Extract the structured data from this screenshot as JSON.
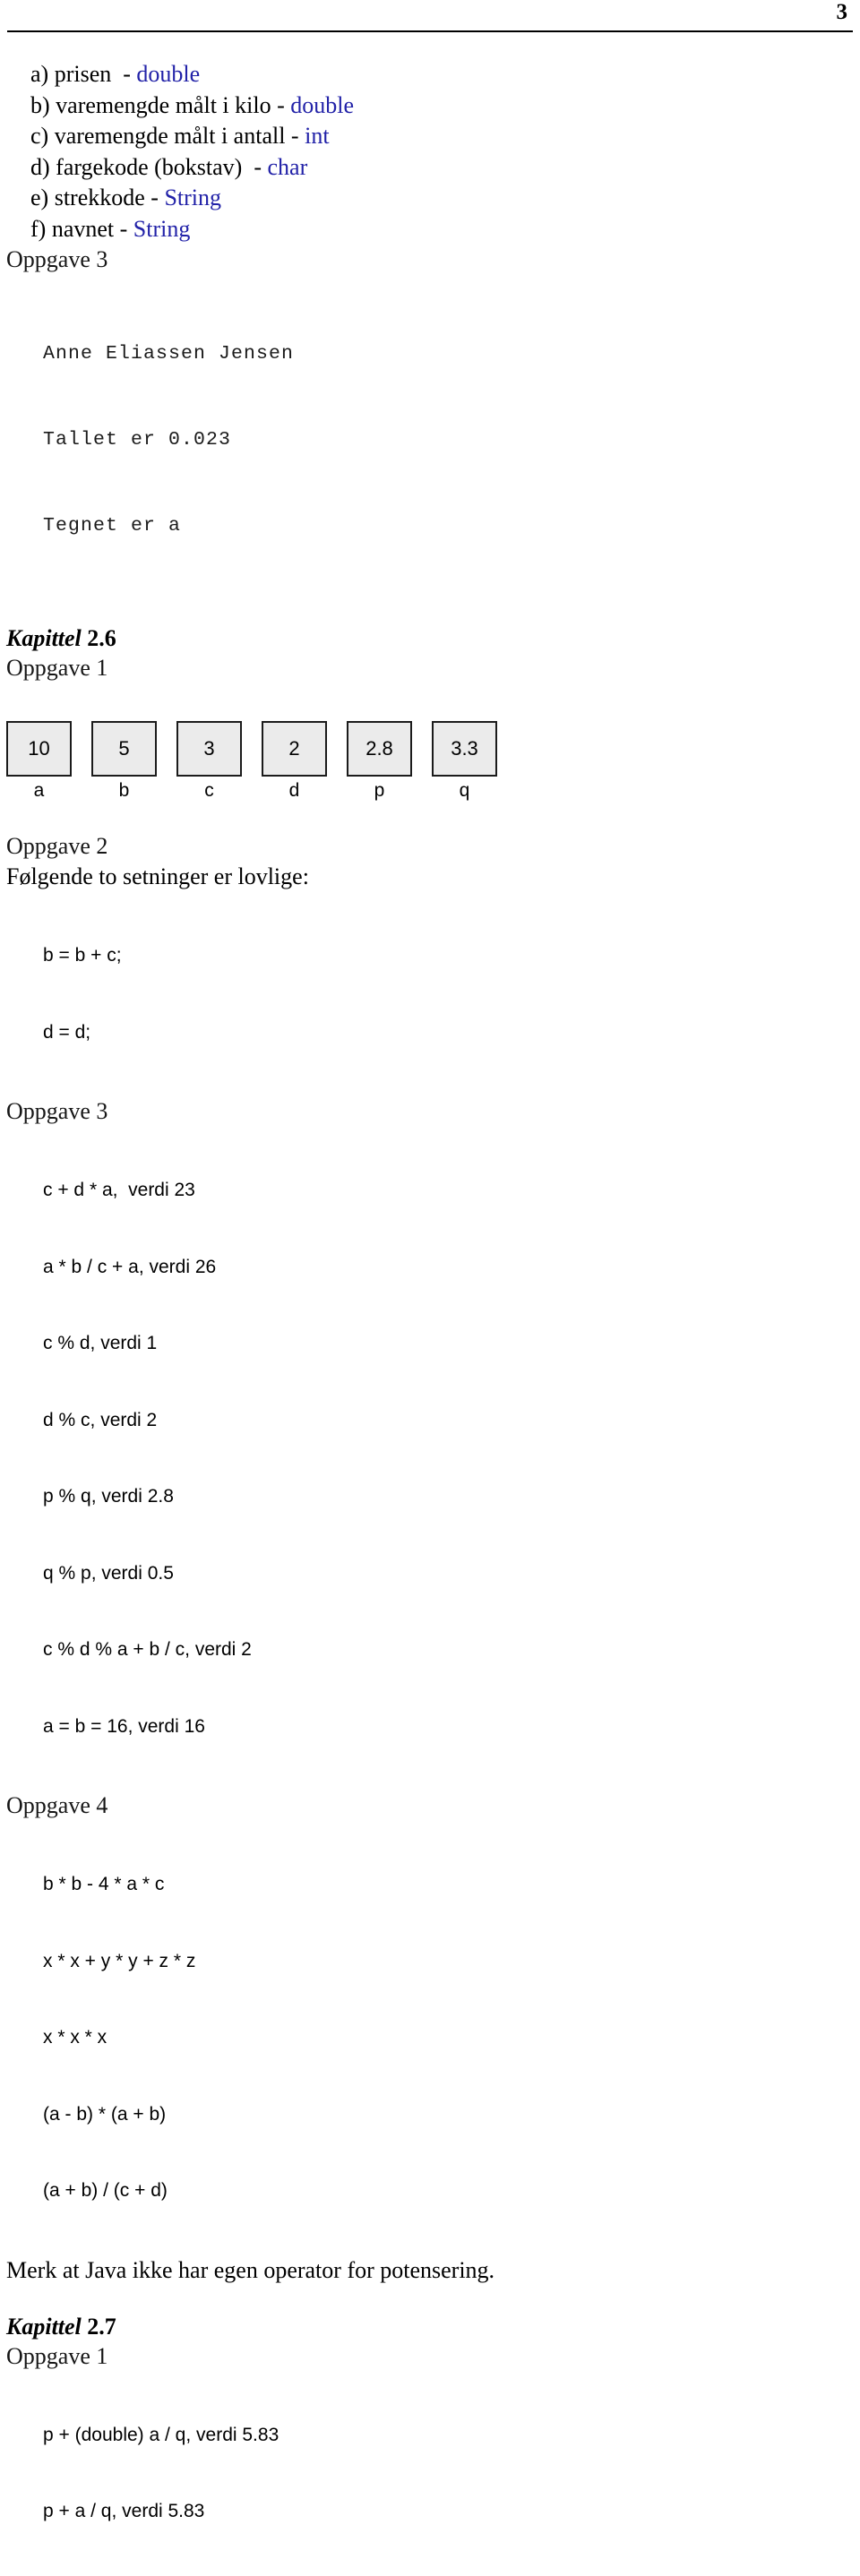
{
  "header": {
    "page_number": "3"
  },
  "types_list": [
    {
      "label": "a) prisen  - ",
      "type": "double"
    },
    {
      "label": "b) varemengde målt i kilo - ",
      "type": "double"
    },
    {
      "label": "c) varemengde målt i antall - ",
      "type": "int"
    },
    {
      "label": "d) fargekode (bokstav)  - ",
      "type": "char"
    },
    {
      "label": "e) strekkode - ",
      "type": "String"
    },
    {
      "label": "f) navnet - ",
      "type": "String"
    }
  ],
  "section_oppgave3_top": {
    "heading": "Oppgave 3",
    "console_lines": [
      "Anne Eliassen Jensen",
      "Tallet er 0.023",
      "Tegnet er a"
    ]
  },
  "kapittel_2_6": {
    "title_word": "Kapittel ",
    "title_number": "2.6",
    "oppgave1": {
      "heading": "Oppgave 1",
      "boxes": [
        {
          "value": "10",
          "label": "a"
        },
        {
          "value": "5",
          "label": "b"
        },
        {
          "value": "3",
          "label": "c"
        },
        {
          "value": "2",
          "label": "d"
        },
        {
          "value": "2.8",
          "label": "p"
        },
        {
          "value": "3.3",
          "label": "q"
        }
      ]
    },
    "oppgave2": {
      "heading": "Oppgave 2",
      "intro": "Følgende to setninger er lovlige:",
      "statements": [
        "b = b + c;",
        "d = d;"
      ]
    },
    "oppgave3": {
      "heading": "Oppgave 3",
      "expressions": [
        "c + d * a,  verdi 23",
        "a * b / c + a, verdi 26",
        "c % d, verdi 1",
        "d % c, verdi 2",
        "p % q, verdi 2.8",
        "q % p, verdi 0.5",
        "c % d % a + b / c, verdi 2",
        "a = b = 16, verdi 16"
      ]
    },
    "oppgave4": {
      "heading": "Oppgave 4",
      "expressions": [
        "b * b - 4 * a * c",
        "x * x + y * y + z * z",
        "x * x * x",
        "(a - b) * (a + b)",
        "(a + b) / (c + d)"
      ],
      "note": "Merk at Java ikke har egen operator for potensering."
    }
  },
  "kapittel_2_7": {
    "title_word": "Kapittel ",
    "title_number": "2.7",
    "oppgave1": {
      "heading": "Oppgave 1",
      "expressions": [
        "p + (double) a / q, verdi 5.83",
        "p + a / q, verdi 5.83"
      ]
    }
  },
  "colors": {
    "keyword_blue": "#2222a8",
    "box_fill": "#ebebeb",
    "box_border": "#1b1b1b",
    "text": "#000000"
  }
}
